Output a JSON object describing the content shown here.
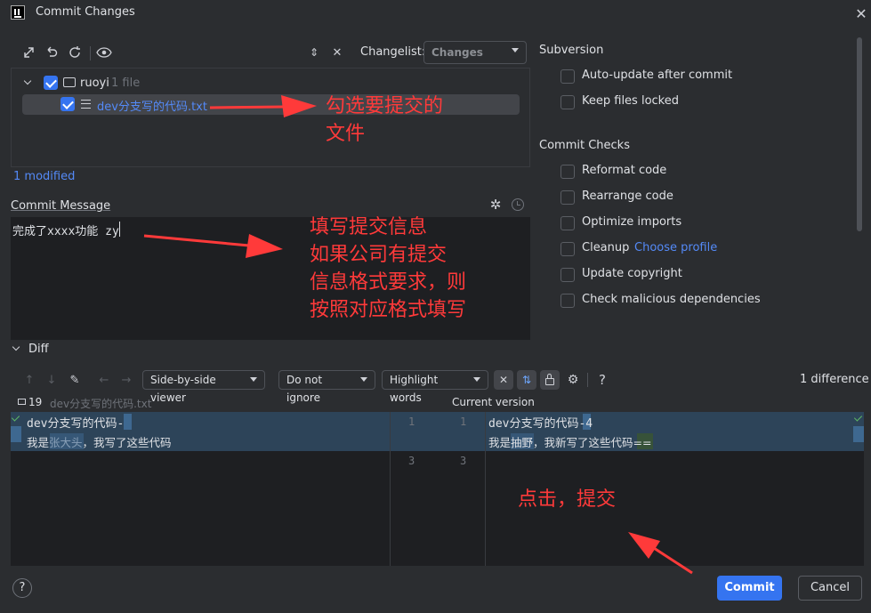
{
  "window": {
    "title": "Commit Changes"
  },
  "toolbar": {
    "changelist_label": "Changelist:",
    "changelist_value": "Changes"
  },
  "tree": {
    "root_label": "ruoyi",
    "root_count": "1 file",
    "file_name": "dev分支写的代码.txt",
    "summary": "1 modified"
  },
  "commit_message": {
    "label": "Commit Message",
    "value": "完成了xxxx功能 zy"
  },
  "subversion": {
    "title": "Subversion",
    "options": [
      {
        "label": "Auto-update after commit",
        "checked": false
      },
      {
        "label": "Keep files locked",
        "checked": false
      }
    ]
  },
  "commit_checks": {
    "title": "Commit Checks",
    "options": [
      {
        "label": "Reformat code",
        "checked": false
      },
      {
        "label": "Rearrange code",
        "checked": false
      },
      {
        "label": "Optimize imports",
        "checked": false
      },
      {
        "label": "Cleanup",
        "checked": false,
        "link": "Choose profile"
      },
      {
        "label": "Update copyright",
        "checked": false
      },
      {
        "label": "Check malicious dependencies",
        "checked": false
      }
    ]
  },
  "diff": {
    "title": "Diff",
    "viewer_mode": "Side-by-side viewer",
    "ignore_mode": "Do not ignore",
    "highlight_mode": "Highlight words",
    "help": "?",
    "difference_count": "1 difference",
    "left_revision": "19",
    "left_file": "dev分支写的代码.txt",
    "right_header": "Current version",
    "left_lines": [
      "dev分支写的代码-2",
      "我是张大头，我写了这些代码"
    ],
    "right_lines": [
      "dev分支写的代码-4",
      "我是抽野，我新写了这些代码=="
    ],
    "gutter_left": [
      "1",
      "3"
    ],
    "gutter_right": [
      "1",
      "3"
    ]
  },
  "footer": {
    "help": "?",
    "commit_label": "Commit",
    "cancel_label": "Cancel"
  },
  "annotations": {
    "select_files": "勾选要提交的\n文件",
    "fill_message": "填写提交信息\n如果公司有提交\n信息格式要求，则\n按照对应格式填写",
    "click_commit": "点击，提交"
  },
  "colors": {
    "accent": "#3574f0",
    "annotation": "#ff3a3a",
    "link": "#548af7"
  }
}
